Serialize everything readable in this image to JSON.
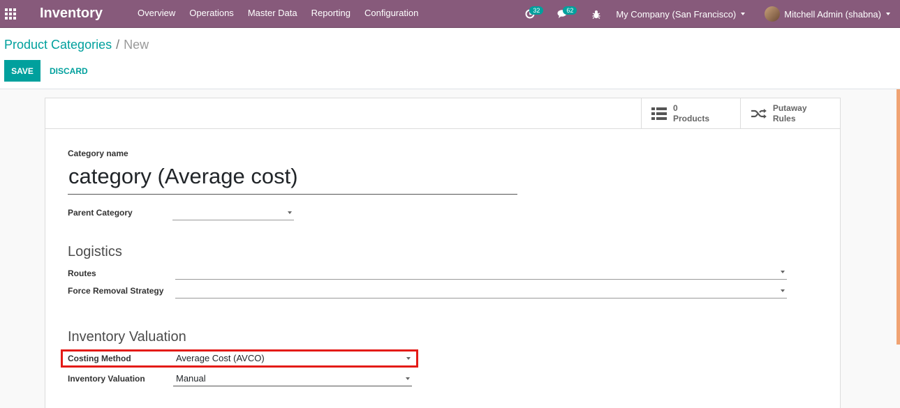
{
  "navbar": {
    "app_title": "Inventory",
    "menu": [
      "Overview",
      "Operations",
      "Master Data",
      "Reporting",
      "Configuration"
    ],
    "activity_count": "32",
    "messages_count": "62",
    "company": "My Company (San Francisco)",
    "user": "Mitchell Admin (shabna)"
  },
  "breadcrumb": {
    "parent": "Product Categories",
    "separator": "/",
    "current": "New"
  },
  "actions": {
    "save_label": "SAVE",
    "discard_label": "DISCARD"
  },
  "smart_buttons": {
    "products_count": "0",
    "products_label": "Products",
    "putaway_label": "Putaway Rules"
  },
  "form": {
    "category_name_label": "Category name",
    "category_name_value": "category (Average cost)",
    "parent_category_label": "Parent Category",
    "parent_category_value": "",
    "logistics_title": "Logistics",
    "routes_label": "Routes",
    "routes_value": "",
    "removal_strategy_label": "Force Removal Strategy",
    "removal_strategy_value": "",
    "valuation_title": "Inventory Valuation",
    "costing_method_label": "Costing Method",
    "costing_method_value": "Average Cost (AVCO)",
    "inventory_valuation_label": "Inventory Valuation",
    "inventory_valuation_value": "Manual"
  },
  "colors": {
    "navbar": "#875a7b",
    "accent": "#00a09d",
    "highlight": "#e41b17"
  }
}
